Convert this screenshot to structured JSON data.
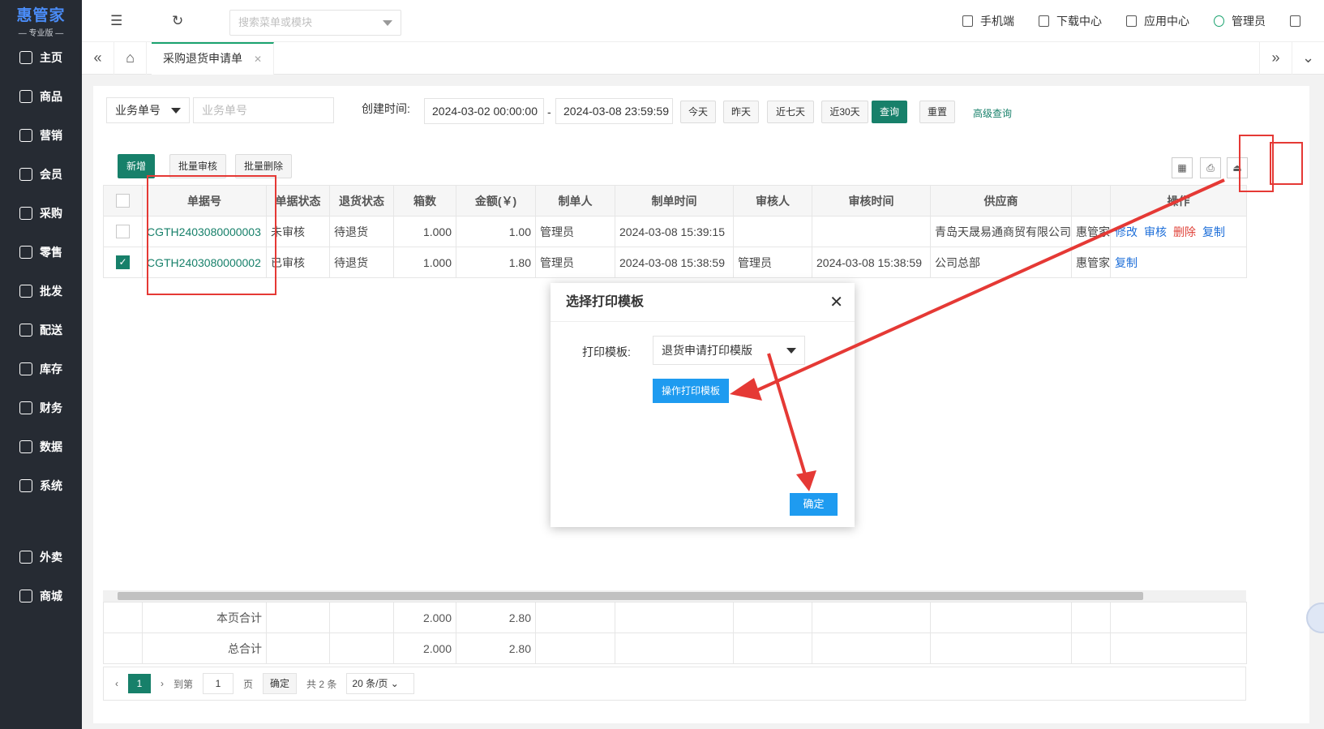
{
  "brand": {
    "name": "惠管家",
    "edition": "专业版"
  },
  "sidebar": {
    "items": [
      {
        "label": "主页",
        "icon": "home-icon"
      },
      {
        "label": "商品",
        "icon": "box-icon"
      },
      {
        "label": "营销",
        "icon": "marketing-icon"
      },
      {
        "label": "会员",
        "icon": "member-icon"
      },
      {
        "label": "采购",
        "icon": "purchase-icon"
      },
      {
        "label": "零售",
        "icon": "retail-icon"
      },
      {
        "label": "批发",
        "icon": "wholesale-icon"
      },
      {
        "label": "配送",
        "icon": "delivery-icon"
      },
      {
        "label": "库存",
        "icon": "inventory-icon"
      },
      {
        "label": "财务",
        "icon": "finance-icon"
      },
      {
        "label": "数据",
        "icon": "data-icon"
      },
      {
        "label": "系统",
        "icon": "system-icon"
      },
      {
        "label": "外卖",
        "icon": "takeout-icon"
      },
      {
        "label": "商城",
        "icon": "mall-icon"
      }
    ]
  },
  "topbar": {
    "search_placeholder": "搜索菜单或模块",
    "mobile": "手机端",
    "download": "下载中心",
    "apps": "应用中心",
    "user": "管理员"
  },
  "tabs": {
    "active": "采购退货申请单"
  },
  "filter": {
    "field_select": "业务单号",
    "field_placeholder": "业务单号",
    "created_label": "创建时间:",
    "date_from": "2024-03-02 00:00:00",
    "date_sep": "-",
    "date_to": "2024-03-08 23:59:59",
    "today": "今天",
    "yesterday": "昨天",
    "last7": "近七天",
    "last30": "近30天",
    "query": "查询",
    "reset": "重置",
    "advanced": "高级查询"
  },
  "toolbar": {
    "add": "新增",
    "batch_audit": "批量审核",
    "batch_delete": "批量删除"
  },
  "table": {
    "headers": [
      "单据号",
      "单据状态",
      "退货状态",
      "箱数",
      "金额(￥)",
      "制单人",
      "制单时间",
      "审核人",
      "审核时间",
      "供应商",
      "",
      "操作"
    ],
    "rows": [
      {
        "code": "CGTH2403080000003",
        "status": "未审核",
        "return_status": "待退货",
        "boxes": "1.000",
        "amount": "1.00",
        "maker": "管理员",
        "make_time": "2024-03-08 15:39:15",
        "auditor": "",
        "audit_time": "",
        "supplier": "青岛天晟易通商贸有限公司",
        "extra": "惠管家",
        "ops": [
          "修改",
          "审核",
          "删除",
          "复制"
        ],
        "checked": false
      },
      {
        "code": "CGTH2403080000002",
        "status": "已审核",
        "return_status": "待退货",
        "boxes": "1.000",
        "amount": "1.80",
        "maker": "管理员",
        "make_time": "2024-03-08 15:38:59",
        "auditor": "管理员",
        "audit_time": "2024-03-08 15:38:59",
        "supplier": "公司总部",
        "extra": "惠管家",
        "ops": [
          "复制"
        ],
        "checked": true
      }
    ]
  },
  "summary": {
    "page_label": "本页合计",
    "page_boxes": "2.000",
    "page_amount": "2.80",
    "total_label": "总合计",
    "total_boxes": "2.000",
    "total_amount": "2.80"
  },
  "pager": {
    "current": "1",
    "goto": "到第",
    "page_input": "1",
    "page_unit": "页",
    "confirm": "确定",
    "total": "共 2 条",
    "size": "20 条/页"
  },
  "modal": {
    "title": "选择打印模板",
    "label": "打印模板:",
    "value": "退货申请打印模版",
    "operate": "操作打印模板",
    "ok": "确定"
  },
  "colors": {
    "accent": "#17806a",
    "sidebar": "#262b33",
    "modal_button": "#1e9bf0",
    "annotation": "#e53935"
  }
}
